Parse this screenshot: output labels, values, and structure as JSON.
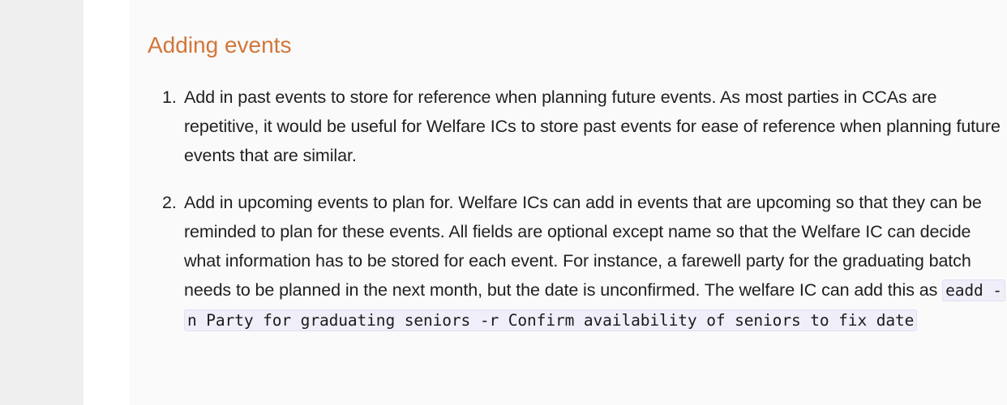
{
  "section": {
    "title": "Adding events"
  },
  "events_list": [
    {
      "number": "1.",
      "text": "Add in past events to store for reference when planning future events. As most parties in CCAs are repetitive, it would be useful for Welfare ICs to store past events for ease of reference when planning future events that are similar."
    },
    {
      "number": "2.",
      "text": "Add in upcoming events to plan for. Welfare ICs can add in events that are upcoming so that they can be reminded to plan for these events. All fields are optional except name so that the Welfare IC can decide what information has to be stored for each event. For instance, a farewell party for the graduating batch needs to be planned in the next month, but the date is unconfirmed. The welfare IC can add this as",
      "code": "eadd -n Party for graduating seniors -r Confirm availability of seniors to fix date"
    }
  ]
}
